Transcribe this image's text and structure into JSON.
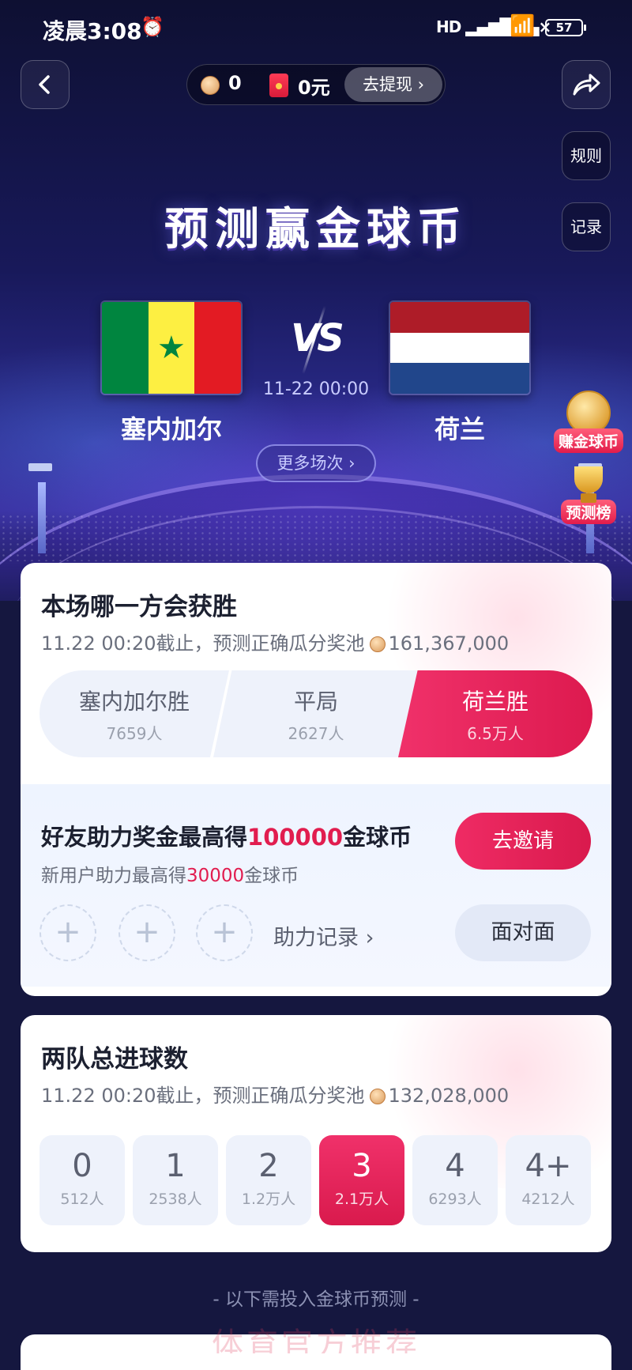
{
  "status_bar": {
    "time": "凌晨3:08",
    "signal": "HD",
    "battery": "57"
  },
  "wallet": {
    "coins": "0",
    "money": "0元",
    "withdraw_label": "去提现"
  },
  "side_buttons": {
    "rules": "规则",
    "records": "记录"
  },
  "hero": {
    "title": "预测赢金球币",
    "vs": "VS",
    "match_time": "11-22 00:00",
    "home_team": "塞内加尔",
    "away_team": "荷兰",
    "more_label": "更多场次"
  },
  "float_badges": {
    "earn": "赚金球币",
    "rank": "预测榜"
  },
  "winner_card": {
    "title": "本场哪一方会获胜",
    "deadline": "11.22 00:20截止，预测正确瓜分奖池",
    "pool": "161,367,000",
    "options": [
      {
        "label": "塞内加尔胜",
        "count": "7659人"
      },
      {
        "label": "平局",
        "count": "2627人"
      },
      {
        "label": "荷兰胜",
        "count": "6.5万人"
      }
    ]
  },
  "helper": {
    "title_pre": "好友助力奖金最高得",
    "title_amount": "100000",
    "title_post": "金球币",
    "sub_pre": "新用户助力最高得",
    "sub_amount": "30000",
    "sub_post": "金球币",
    "invite_label": "去邀请",
    "log_label": "助力记录",
    "face_label": "面对面"
  },
  "goals_card": {
    "title": "两队总进球数",
    "deadline": "11.22 00:20截止，预测正确瓜分奖池",
    "pool": "132,028,000",
    "options": [
      {
        "label": "0",
        "count": "512人"
      },
      {
        "label": "1",
        "count": "2538人"
      },
      {
        "label": "2",
        "count": "1.2万人"
      },
      {
        "label": "3",
        "count": "2.1万人"
      },
      {
        "label": "4",
        "count": "6293人"
      },
      {
        "label": "4+",
        "count": "4212人"
      }
    ]
  },
  "footer_note": "- 以下需投入金球币预测 -",
  "watermark": "体育官方推荐",
  "colors": {
    "accent": "#e11d4f",
    "hero_bg": "#18195a",
    "senegal_green": "#00853f",
    "senegal_yellow": "#fdef42",
    "senegal_red": "#e31b23",
    "nl_red": "#ae1c28",
    "nl_blue": "#21468b"
  },
  "icons": {
    "back": "back-arrow-icon",
    "share": "share-icon",
    "alarm": "alarm-icon",
    "wifi": "wifi-icon"
  }
}
